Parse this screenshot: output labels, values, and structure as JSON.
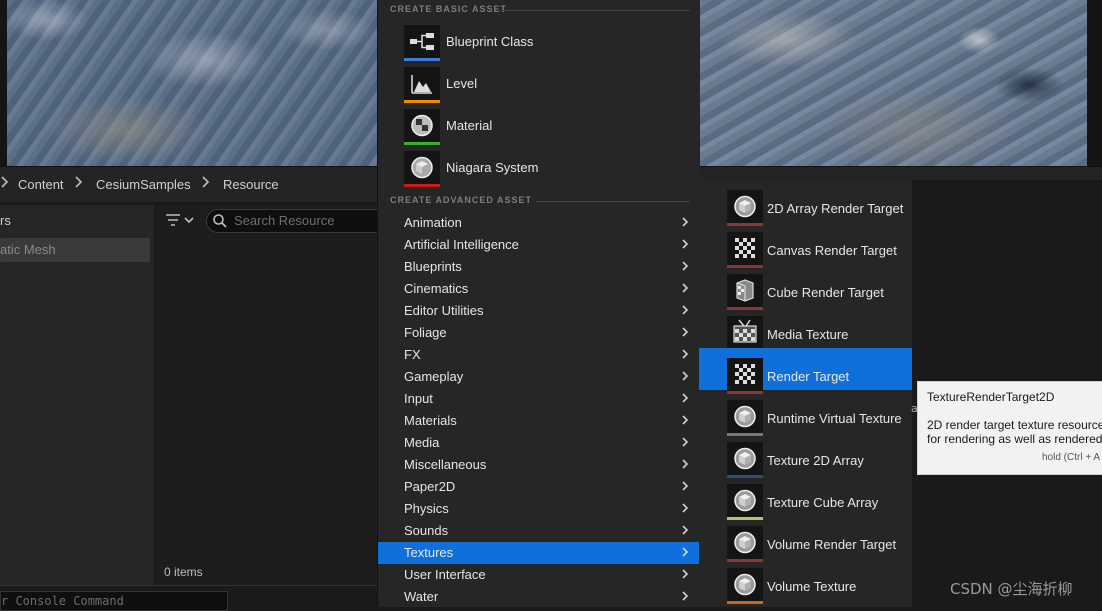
{
  "breadcrumb": {
    "items": [
      "Content",
      "CesiumSamples",
      "Resource"
    ]
  },
  "sources": {
    "title": "rs",
    "item": "atic Mesh"
  },
  "asset_view": {
    "search_placeholder": "Search Resource",
    "item_count": "0 items"
  },
  "console": {
    "placeholder": "r Console Command"
  },
  "menu": {
    "basic_header": "CREATE BASIC ASSET",
    "basic_items": [
      {
        "label": "Blueprint Class",
        "icon": "blueprint-icon",
        "strip_color": "#3a7bd5"
      },
      {
        "label": "Level",
        "icon": "level-icon",
        "strip_color": "#f08c00"
      },
      {
        "label": "Material",
        "icon": "material-icon",
        "strip_color": "#3dae2b"
      },
      {
        "label": "Niagara System",
        "icon": "niagara-icon",
        "strip_color": "#d21a1a"
      }
    ],
    "advanced_header": "CREATE ADVANCED ASSET",
    "advanced_items": [
      {
        "label": "Animation"
      },
      {
        "label": "Artificial Intelligence"
      },
      {
        "label": "Blueprints"
      },
      {
        "label": "Cinematics"
      },
      {
        "label": "Editor Utilities"
      },
      {
        "label": "Foliage"
      },
      {
        "label": "FX"
      },
      {
        "label": "Gameplay"
      },
      {
        "label": "Input"
      },
      {
        "label": "Materials"
      },
      {
        "label": "Media"
      },
      {
        "label": "Miscellaneous"
      },
      {
        "label": "Paper2D"
      },
      {
        "label": "Physics"
      },
      {
        "label": "Sounds"
      },
      {
        "label": "Textures"
      },
      {
        "label": "User Interface"
      },
      {
        "label": "Water"
      }
    ],
    "active_item": "Textures"
  },
  "submenu": {
    "items": [
      {
        "label": "2D Array Render Target",
        "icon": "sphere-icon",
        "strip_color": "#8a3434"
      },
      {
        "label": "Canvas Render Target",
        "icon": "checker-icon",
        "strip_color": "#8a3434"
      },
      {
        "label": "Cube Render Target",
        "icon": "cube-texture-icon",
        "strip_color": "#8a3434"
      },
      {
        "label": "Media Texture",
        "icon": "media-texture-icon",
        "strip_color": "#d21a1a"
      },
      {
        "label": "Render Target",
        "icon": "checker-icon",
        "strip_color": "#8a3434"
      },
      {
        "label": "Runtime Virtual Texture",
        "icon": "sphere-icon",
        "strip_color": "#777777"
      },
      {
        "label": "Texture 2D Array",
        "icon": "sphere-icon",
        "strip_color": "#2a4f7a"
      },
      {
        "label": "Texture Cube Array",
        "icon": "sphere-icon",
        "strip_color": "#b8c070"
      },
      {
        "label": "Volume Render Target",
        "icon": "sphere-icon",
        "strip_color": "#8a3434"
      },
      {
        "label": "Volume Texture",
        "icon": "sphere-icon",
        "strip_color": "#c46a20"
      }
    ],
    "active_item": "Render Target"
  },
  "tooltip": {
    "title": "TextureRenderTarget2D",
    "desc_line1": "2D render target texture resource",
    "desc_line2": "for rendering as well as rendered",
    "hint": "hold (Ctrl + A"
  },
  "stray_text": "a",
  "watermark": "CSDN @尘海折柳",
  "colors": {
    "accent": "#0f6fdb",
    "menu_bg": "#262626",
    "tooltip_bg": "#f2f2f2"
  }
}
